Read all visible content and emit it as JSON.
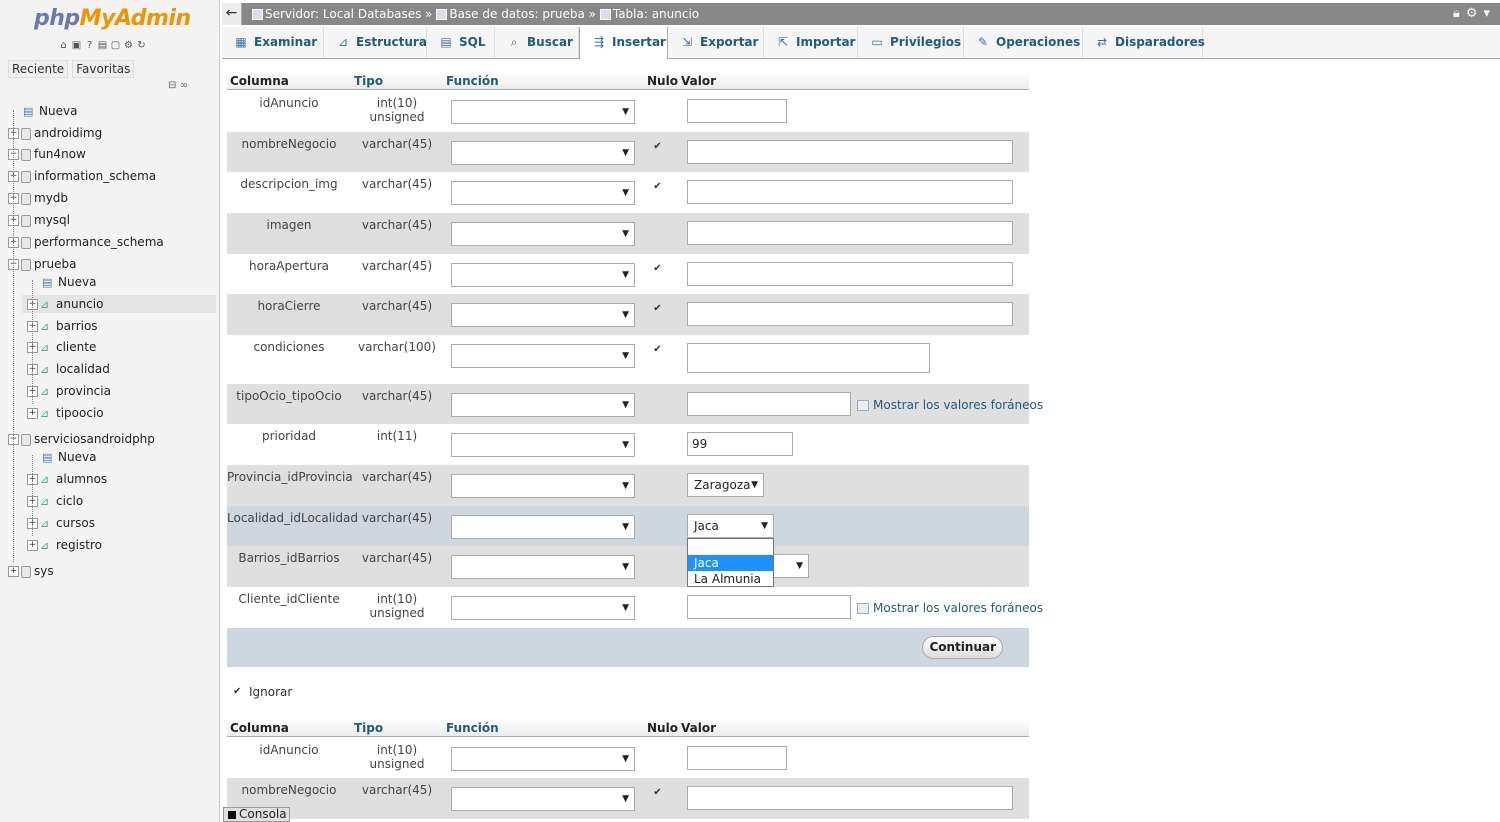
{
  "logo": {
    "php": "php",
    "my": "My",
    "admin": "Admin"
  },
  "left_tabs": {
    "recent": "Reciente",
    "favorites": "Favoritas"
  },
  "tree": [
    {
      "label": "Nueva",
      "level": 0,
      "kind": "new"
    },
    {
      "label": "androidimg",
      "level": 0,
      "kind": "db",
      "exp": "+"
    },
    {
      "label": "fun4now",
      "level": 0,
      "kind": "db",
      "exp": "−"
    },
    {
      "label": "information_schema",
      "level": 0,
      "kind": "db",
      "exp": "+"
    },
    {
      "label": "mydb",
      "level": 0,
      "kind": "db",
      "exp": "+"
    },
    {
      "label": "mysql",
      "level": 0,
      "kind": "db",
      "exp": "+"
    },
    {
      "label": "performance_schema",
      "level": 0,
      "kind": "db",
      "exp": "+"
    },
    {
      "label": "prueba",
      "level": 0,
      "kind": "db",
      "exp": "−"
    },
    {
      "label": "Nueva",
      "level": 1,
      "kind": "new"
    },
    {
      "label": "anuncio",
      "level": 1,
      "kind": "table",
      "exp": "+",
      "selected": true
    },
    {
      "label": "barrios",
      "level": 1,
      "kind": "table",
      "exp": "+"
    },
    {
      "label": "cliente",
      "level": 1,
      "kind": "table",
      "exp": "+"
    },
    {
      "label": "localidad",
      "level": 1,
      "kind": "table",
      "exp": "+"
    },
    {
      "label": "provincia",
      "level": 1,
      "kind": "table",
      "exp": "+"
    },
    {
      "label": "tipoocio",
      "level": 1,
      "kind": "table",
      "exp": "+"
    },
    {
      "label": "serviciosandroidphp",
      "level": 0,
      "kind": "db",
      "exp": "−"
    },
    {
      "label": "Nueva",
      "level": 1,
      "kind": "new"
    },
    {
      "label": "alumnos",
      "level": 1,
      "kind": "table",
      "exp": "+"
    },
    {
      "label": "ciclo",
      "level": 1,
      "kind": "table",
      "exp": "+"
    },
    {
      "label": "cursos",
      "level": 1,
      "kind": "table",
      "exp": "+"
    },
    {
      "label": "registro",
      "level": 1,
      "kind": "table",
      "exp": "+"
    },
    {
      "label": "sys",
      "level": 0,
      "kind": "db",
      "exp": "+"
    }
  ],
  "breadcrumb": {
    "server": "Servidor: Local Databases",
    "sep1": "»",
    "db": "Base de datos: prueba",
    "sep2": "»",
    "table": "Tabla: anuncio"
  },
  "tabs": [
    {
      "label": "Examinar",
      "icon": "table-icon"
    },
    {
      "label": "Estructura",
      "icon": "structure-icon"
    },
    {
      "label": "SQL",
      "icon": "sql-icon"
    },
    {
      "label": "Buscar",
      "icon": "search-icon"
    },
    {
      "label": "Insertar",
      "icon": "insert-icon",
      "active": true
    },
    {
      "label": "Exportar",
      "icon": "export-icon"
    },
    {
      "label": "Importar",
      "icon": "import-icon"
    },
    {
      "label": "Privilegios",
      "icon": "privileges-icon"
    },
    {
      "label": "Operaciones",
      "icon": "wrench-icon"
    },
    {
      "label": "Disparadores",
      "icon": "triggers-icon"
    }
  ],
  "headers": {
    "column": "Columna",
    "type": "Tipo",
    "function": "Función",
    "null": "Nulo",
    "value": "Valor"
  },
  "rows": [
    {
      "column": "idAnuncio",
      "type": "int(10) unsigned",
      "null": false,
      "value": ""
    },
    {
      "column": "nombreNegocio",
      "type": "varchar(45)",
      "null": true,
      "value": ""
    },
    {
      "column": "descripcion_img",
      "type": "varchar(45)",
      "null": true,
      "value": ""
    },
    {
      "column": "imagen",
      "type": "varchar(45)",
      "null": false,
      "value": ""
    },
    {
      "column": "horaApertura",
      "type": "varchar(45)",
      "null": true,
      "value": ""
    },
    {
      "column": "horaCierre",
      "type": "varchar(45)",
      "null": true,
      "value": ""
    },
    {
      "column": "condiciones",
      "type": "varchar(100)",
      "null": true,
      "value": ""
    },
    {
      "column": "tipoOcio_tipoOcio",
      "type": "varchar(45)",
      "null": false,
      "value": "",
      "foreign_link": "Mostrar los valores foráneos"
    },
    {
      "column": "prioridad",
      "type": "int(11)",
      "null": false,
      "value": "99"
    },
    {
      "column": "Provincia_idProvincia",
      "type": "varchar(45)",
      "null": false,
      "value": "Zaragoza"
    },
    {
      "column": "Localidad_idLocalidad",
      "type": "varchar(45)",
      "null": false,
      "value": "Jaca"
    },
    {
      "column": "Barrios_idBarrios",
      "type": "varchar(45)",
      "null": false,
      "value": ""
    },
    {
      "column": "Cliente_idCliente",
      "type": "int(10) unsigned",
      "null": false,
      "value": "",
      "foreign_link": "Mostrar los valores foráneos"
    }
  ],
  "dropdown_options": [
    "",
    "Jaca",
    "La Almunia"
  ],
  "continue_label": "Continuar",
  "ignore_label": "Ignorar",
  "rows2": [
    {
      "column": "idAnuncio",
      "type": "int(10) unsigned",
      "null": false,
      "value": ""
    },
    {
      "column": "nombreNegocio",
      "type": "varchar(45)",
      "null": true,
      "value": ""
    }
  ],
  "console_label": "Consola"
}
